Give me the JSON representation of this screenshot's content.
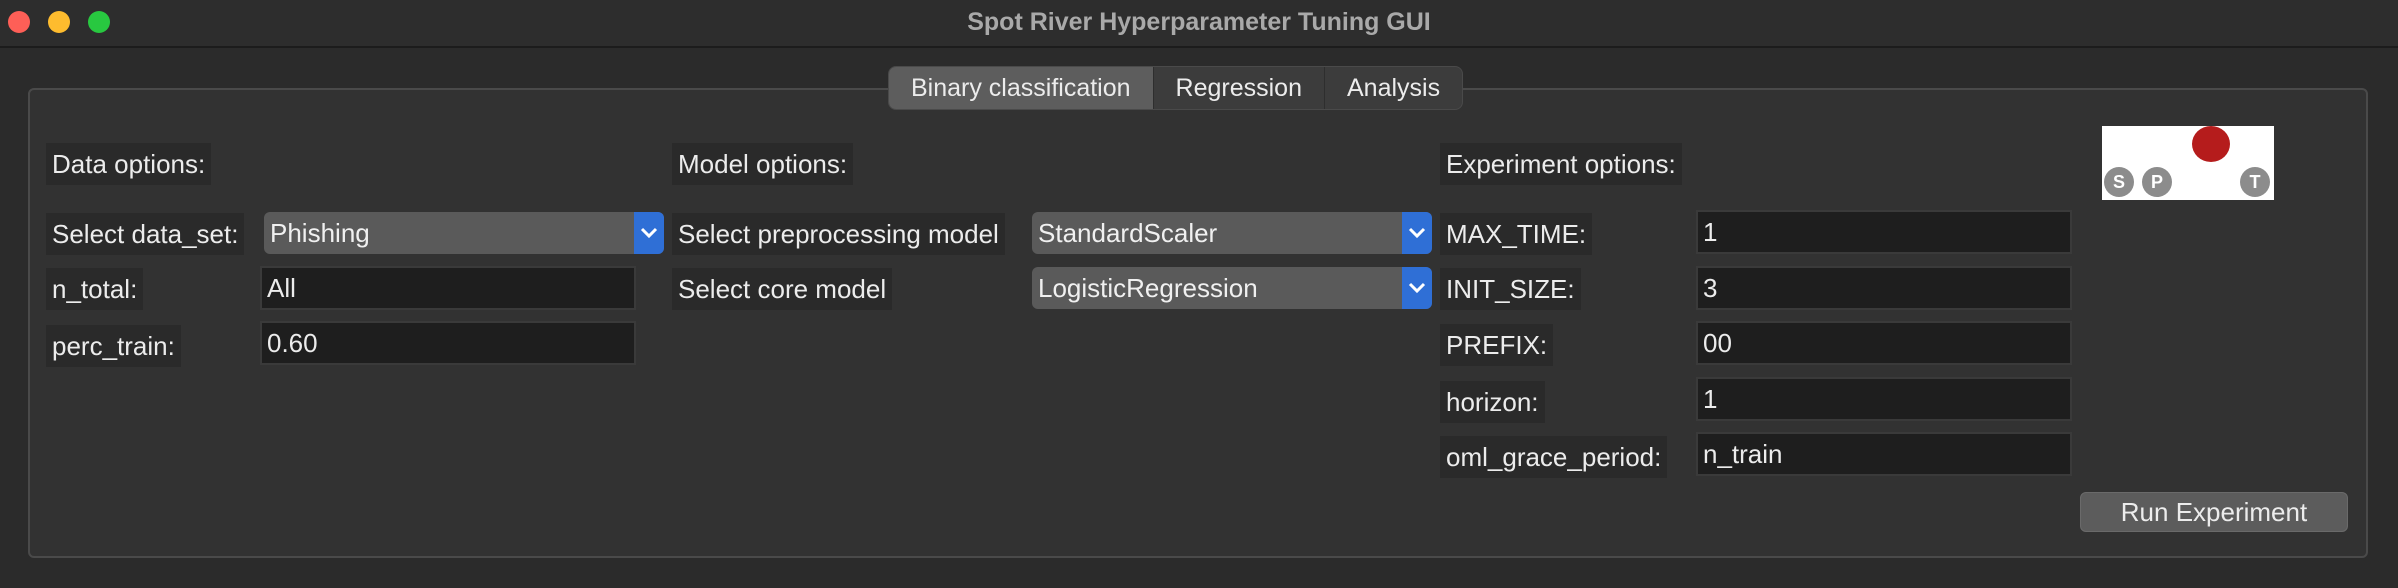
{
  "window": {
    "title": "Spot River Hyperparameter Tuning GUI"
  },
  "tabs": [
    {
      "label": "Binary classification",
      "active": true
    },
    {
      "label": "Regression",
      "active": false
    },
    {
      "label": "Analysis",
      "active": false
    }
  ],
  "data_options": {
    "heading": "Data options:",
    "data_set_label": "Select data_set:",
    "data_set_value": "Phishing",
    "n_total_label": "n_total:",
    "n_total_value": "All",
    "perc_train_label": "perc_train:",
    "perc_train_value": "0.60"
  },
  "model_options": {
    "heading": "Model options:",
    "preprocessing_label": "Select preprocessing model",
    "preprocessing_value": "StandardScaler",
    "core_label": "Select core model",
    "core_value": "LogisticRegression"
  },
  "experiment_options": {
    "heading": "Experiment options:",
    "max_time_label": "MAX_TIME:",
    "max_time_value": "1",
    "init_size_label": "INIT_SIZE:",
    "init_size_value": "3",
    "prefix_label": "PREFIX:",
    "prefix_value": "00",
    "horizon_label": "horizon:",
    "horizon_value": "1",
    "oml_label": "oml_grace_period:",
    "oml_value": "n_train"
  },
  "logo": {
    "letters": [
      "S",
      "P",
      "T"
    ]
  },
  "run_button": {
    "label": "Run Experiment"
  },
  "colors": {
    "accent": "#2f6fd6",
    "logo_red": "#b51c1c"
  }
}
